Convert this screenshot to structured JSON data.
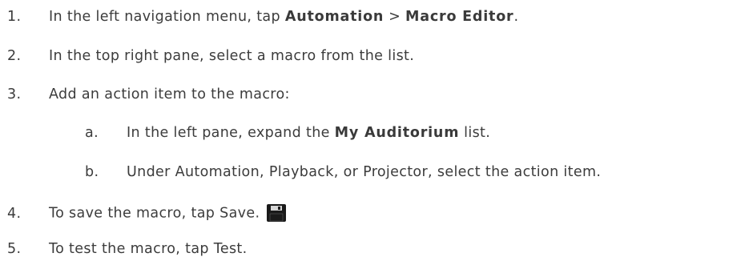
{
  "steps": [
    {
      "number": "1.",
      "text_before": "In the left navigation menu, tap ",
      "bold_1": "Automation",
      "separator": " > ",
      "bold_2": "Macro Editor",
      "text_after": "."
    },
    {
      "number": "2.",
      "text": "In the top right pane, select a macro from the list."
    },
    {
      "number": "3.",
      "text": "Add an action item to the macro:",
      "substeps": [
        {
          "letter": "a.",
          "text_before": "In the left pane, expand the ",
          "bold": "My Auditorium",
          "text_after": " list."
        },
        {
          "letter": "b.",
          "text": "Under Automation, Playback, or Projector, select the action item."
        }
      ]
    },
    {
      "number": "4.",
      "text": "To save the macro, tap Save.",
      "icon": "save-icon"
    },
    {
      "number": "5.",
      "text": "To test the macro, tap Test."
    }
  ],
  "colors": {
    "text": "#3c3c3c",
    "icon_fill": "#1a1a1a",
    "icon_accent": "#d6d6d6"
  }
}
